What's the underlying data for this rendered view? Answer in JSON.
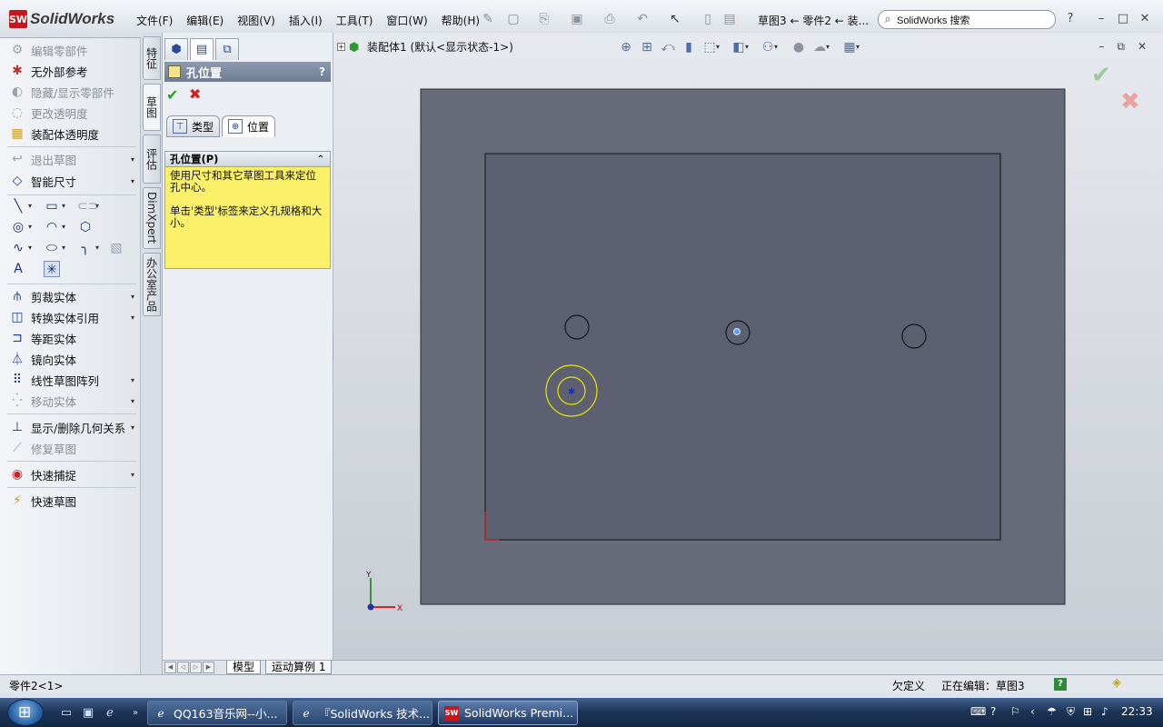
{
  "app": {
    "logo_badge": "SW",
    "logo_text": "SolidWorks"
  },
  "menu": [
    "文件(F)",
    "编辑(E)",
    "视图(V)",
    "插入(I)",
    "工具(T)",
    "窗口(W)",
    "帮助(H)"
  ],
  "doc_title": "草图3 ← 零件2 ← 装...",
  "search": {
    "value": "SolidWorks 搜索"
  },
  "commands": [
    {
      "label": "编辑零部件",
      "icon": "edit-component-icon",
      "disabled": true
    },
    {
      "label": "无外部参考",
      "icon": "no-external-refs-icon",
      "disabled": false
    },
    {
      "label": "隐藏/显示零部件",
      "icon": "hide-show-icon",
      "disabled": true
    },
    {
      "label": "更改透明度",
      "icon": "transparency-icon",
      "disabled": true
    },
    {
      "label": "装配体透明度",
      "icon": "assembly-transparency-icon",
      "disabled": false
    },
    {
      "label": "退出草图",
      "icon": "exit-sketch-icon",
      "disabled": true
    },
    {
      "label": "智能尺寸",
      "icon": "smart-dimension-icon",
      "disabled": false
    },
    {
      "label": "剪裁实体",
      "icon": "trim-icon",
      "disabled": false
    },
    {
      "label": "转换实体引用",
      "icon": "convert-entities-icon",
      "disabled": false
    },
    {
      "label": "等距实体",
      "icon": "offset-icon",
      "disabled": false
    },
    {
      "label": "镜向实体",
      "icon": "mirror-icon",
      "disabled": false
    },
    {
      "label": "线性草图阵列",
      "icon": "linear-pattern-icon",
      "disabled": false
    },
    {
      "label": "移动实体",
      "icon": "move-entities-icon",
      "disabled": true
    },
    {
      "label": "显示/删除几何关系",
      "icon": "relations-icon",
      "disabled": false
    },
    {
      "label": "修复草图",
      "icon": "repair-sketch-icon",
      "disabled": true
    },
    {
      "label": "快速捕捉",
      "icon": "quick-snap-icon",
      "disabled": false
    },
    {
      "label": "快速草图",
      "icon": "rapid-sketch-icon",
      "disabled": false
    }
  ],
  "vertical_tabs": [
    "特征",
    "草图",
    "评估",
    "DimXpert",
    "办公室产品"
  ],
  "property_manager": {
    "title": "孔位置",
    "help": "?",
    "tab_type": "类型",
    "tab_position": "位置",
    "group_title": "孔位置(P)",
    "message_1": "使用尺寸和其它草图工具来定位孔中心。",
    "message_2": "单击'类型'标签来定义孔规格和大小。"
  },
  "tree": {
    "expander": "+",
    "assembly": "装配体1  (默认<显示状态-1>)"
  },
  "axes": {
    "x": "X",
    "y": "Y"
  },
  "bottom_tabs": [
    "模型",
    "运动算例 1"
  ],
  "status": {
    "part": "零件2<1>",
    "definition": "欠定义",
    "editing": "正在编辑：草图3",
    "help": "?"
  },
  "taskbar": {
    "tasks": [
      "QQ163音乐网--小...",
      "『SolidWorks 技术...",
      "SolidWorks Premi..."
    ],
    "active_task": 2,
    "clock": "22:33"
  },
  "colors": {
    "accent_red": "#c8161d",
    "yellow_hint": "#faf06a",
    "part_face": "#656a78",
    "sketch_face": "#5b5f6c",
    "selection": "#e6e600"
  }
}
